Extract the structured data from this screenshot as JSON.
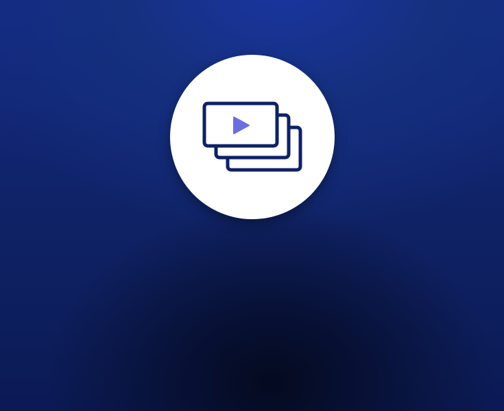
{
  "screen": {
    "background": {
      "top_color": "#1a35a0",
      "bottom_color": "#040a1e"
    },
    "badge": {
      "background_color": "#ffffff",
      "icon": "video-stack-icon",
      "icon_stroke_color": "#0f2166",
      "play_color": "#6c6fe0"
    }
  }
}
